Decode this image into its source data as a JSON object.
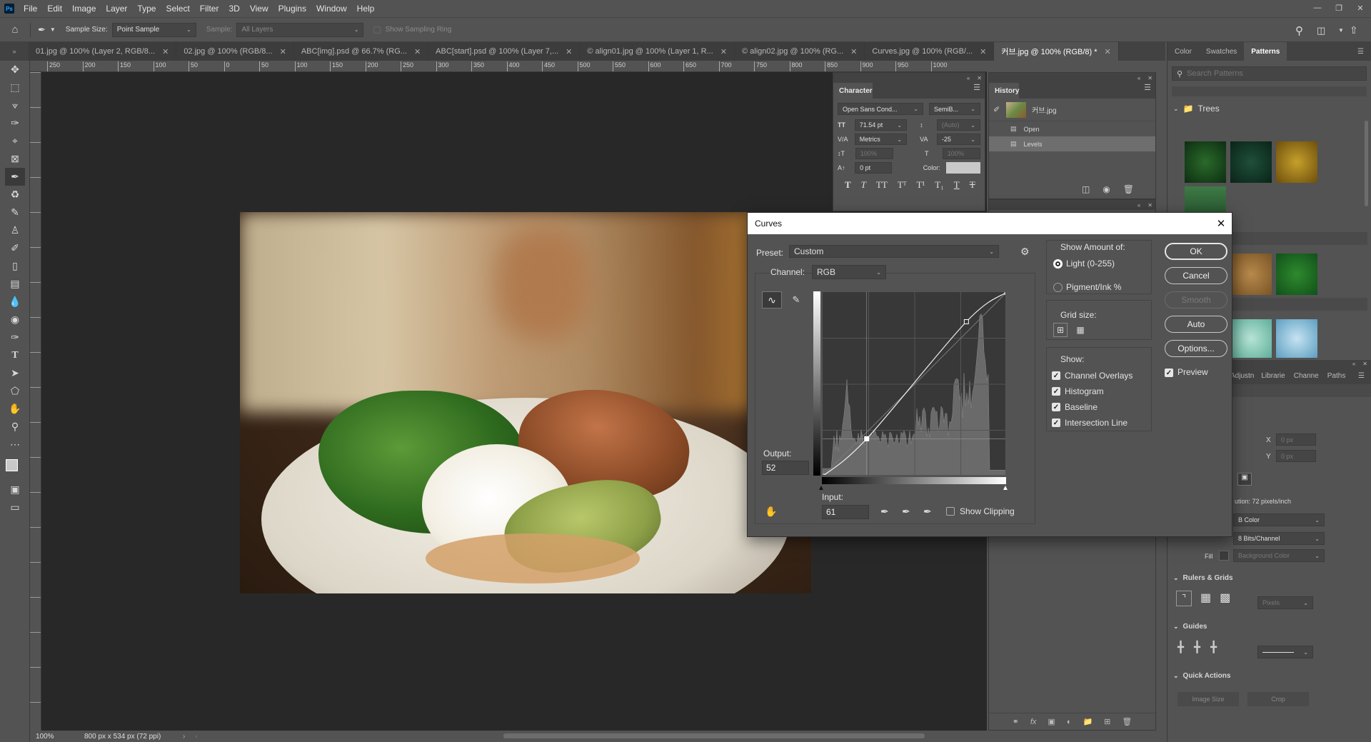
{
  "menu": {
    "logo": "Ps",
    "items": [
      "File",
      "Edit",
      "Image",
      "Layer",
      "Type",
      "Select",
      "Filter",
      "3D",
      "View",
      "Plugins",
      "Window",
      "Help"
    ]
  },
  "options_bar": {
    "sample_size_label": "Sample Size:",
    "sample_size_value": "Point Sample",
    "sample_label": "Sample:",
    "sample_value": "All Layers",
    "show_sampling_ring": "Show Sampling Ring"
  },
  "tabs": [
    "01.jpg @ 100% (Layer 2, RGB/8...",
    "02.jpg @ 100% (RGB/8...",
    "ABC[img].psd @ 66.7% (RG...",
    "ABC[start].psd @ 100% (Layer 7,...",
    "© align01.jpg @ 100% (Layer 1, R...",
    "© align02.jpg @ 100% (RG...",
    "Curves.jpg @ 100% (RGB/...",
    "커브.jpg @ 100% (RGB/8) *"
  ],
  "ruler_h_labels": [
    "250",
    "200",
    "150",
    "100",
    "50",
    "0",
    "50",
    "100",
    "150",
    "200",
    "250",
    "300",
    "350",
    "400",
    "450",
    "500",
    "550",
    "600",
    "650",
    "700",
    "750",
    "800",
    "850",
    "900",
    "950",
    "1000"
  ],
  "statusbar": {
    "zoom": "100%",
    "doc_info": "800 px x 534 px (72 ppi)"
  },
  "character_panel": {
    "title": "Character",
    "font_family": "Open Sans Cond...",
    "font_style": "SemiB...",
    "size": "71.54 pt",
    "leading": "(Auto)",
    "kerning": "Metrics",
    "tracking": "-25",
    "vscale": "100%",
    "hscale": "100%",
    "baseline": "0 pt",
    "color_label": "Color:"
  },
  "history_panel": {
    "title": "History",
    "snapshot": "커브.jpg",
    "items": [
      "Open",
      "Levels"
    ]
  },
  "right_panel": {
    "tabs": [
      "Color",
      "Swatches",
      "Patterns"
    ],
    "search_placeholder": "Search Patterns",
    "group_trees": "Trees",
    "sub_tabs": [
      "Adjustn",
      "Librarie",
      "Channe",
      "Paths"
    ],
    "x_label": "X",
    "y_label": "Y",
    "x_value": "0 px",
    "y_value": "0 px",
    "resolution": "ution: 72 pixels/inch",
    "mode": "B Color",
    "bits": "8 Bits/Channel",
    "fill_label": "Fill",
    "fill_value": "Background Color",
    "rulers_grids": "Rulers & Grids",
    "units": "Pixels",
    "guides": "Guides",
    "quick_actions": "Quick Actions",
    "image_size": "Image Size",
    "crop": "Crop"
  },
  "curves": {
    "title": "Curves",
    "preset_label": "Preset:",
    "preset_value": "Custom",
    "channel_label": "Channel:",
    "channel_value": "RGB",
    "output_label": "Output:",
    "output_value": "52",
    "input_label": "Input:",
    "input_value": "61",
    "show_clipping": "Show Clipping",
    "show_amount_label": "Show Amount of:",
    "light_option": "Light  (0-255)",
    "pigment_option": "Pigment/Ink %",
    "grid_size_label": "Grid size:",
    "show_label": "Show:",
    "show_options": [
      "Channel Overlays",
      "Histogram",
      "Baseline",
      "Intersection Line"
    ],
    "buttons": {
      "ok": "OK",
      "cancel": "Cancel",
      "smooth": "Smooth",
      "auto": "Auto",
      "options": "Options..."
    },
    "preview": "Preview",
    "curve_points": [
      [
        0,
        0
      ],
      [
        61,
        52
      ],
      [
        199,
        214
      ],
      [
        255,
        255
      ]
    ]
  }
}
